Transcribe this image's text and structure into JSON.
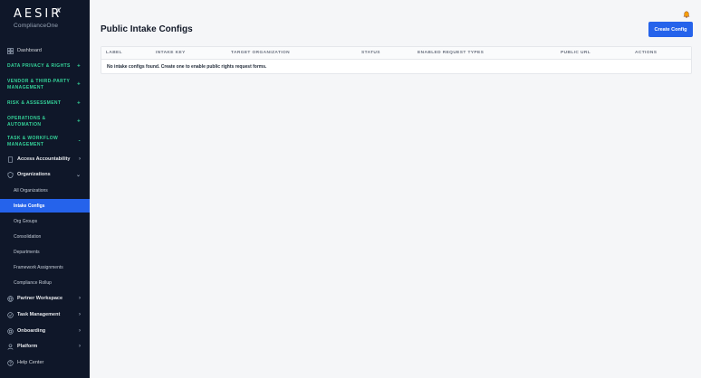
{
  "brand": {
    "name": "AESIR",
    "sub": "ComplianceOne"
  },
  "sidebar": {
    "dashboard": "Dashboard",
    "sections": [
      {
        "label": "DATA PRIVACY & RIGHTS",
        "icon": "+"
      },
      {
        "label": "VENDOR & THIRD-PARTY MANAGEMENT",
        "icon": "+"
      },
      {
        "label": "RISK & ASSESSMENT",
        "icon": "+"
      },
      {
        "label": "OPERATIONS & AUTOMATION",
        "icon": "+"
      },
      {
        "label": "TASK & WORKFLOW MANAGEMENT",
        "icon": "-"
      }
    ],
    "access_accountability": "Access Accountability",
    "organizations": "Organizations",
    "org_items": [
      "All Organizations",
      "Intake Configs",
      "Org Groups",
      "Consolidation",
      "Departments",
      "Framework Assignments",
      "Compliance Rollup"
    ],
    "bottom_items": [
      "Partner Workspace",
      "Task Management",
      "Onboarding",
      "Platform",
      "Help Center"
    ]
  },
  "main": {
    "title": "Public Intake Configs",
    "create_button": "Create Config",
    "columns": [
      "LABEL",
      "INTAKE KEY",
      "TARGET ORGANIZATION",
      "STATUS",
      "ENABLED REQUEST TYPES",
      "PUBLIC URL",
      "ACTIONS"
    ],
    "empty_message": "No intake configs found. Create one to enable public rights request forms."
  },
  "colors": {
    "sidebar_bg": "#0f1729",
    "accent": "#2563eb",
    "section_green": "#34d399"
  }
}
